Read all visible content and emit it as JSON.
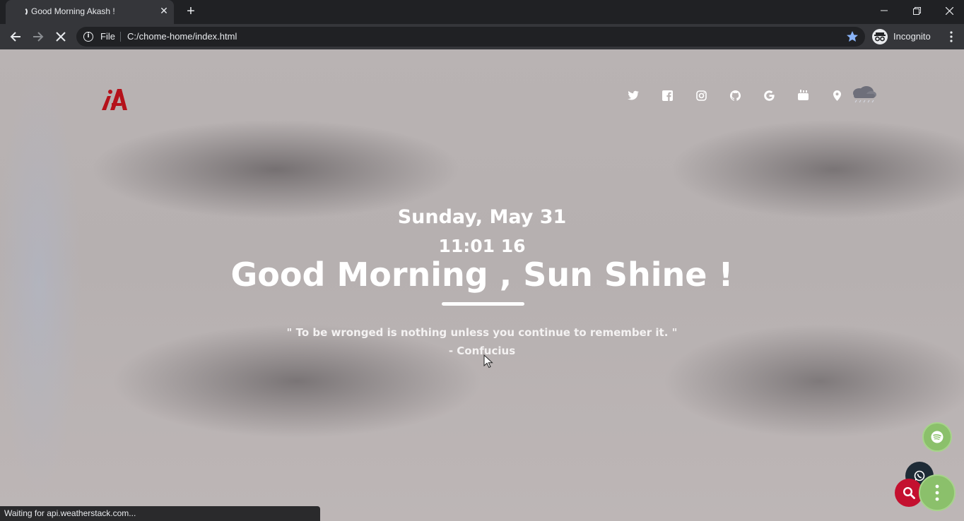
{
  "browser": {
    "tab_title": "Good Morning Akash !",
    "omnibox": {
      "scheme_label": "File",
      "url": "C:/chome-home/index.html"
    },
    "profile_label": "Incognito",
    "status_text": "Waiting for api.weatherstack.com..."
  },
  "page": {
    "date": "Sunday, May 31",
    "time": "11:01 16",
    "greeting": "Good Morning , Sun Shine !",
    "quote": "\" To be wronged is nothing unless you continue to remember it. \"",
    "author": "- Confucius",
    "social_icons": [
      "twitter-icon",
      "facebook-icon",
      "instagram-icon",
      "github-icon",
      "google-icon",
      "youtube-icon",
      "location-icon"
    ],
    "weather_icon": "rain-cloud-icon"
  },
  "colors": {
    "chrome_dark": "#202124",
    "chrome_toolbar": "#35363a",
    "logo_red": "#b5121b",
    "fab_green": "#8bc06b",
    "fab_red": "#c4102f",
    "fab_navy": "#1e2b36",
    "star_blue": "#8ab4f8"
  }
}
